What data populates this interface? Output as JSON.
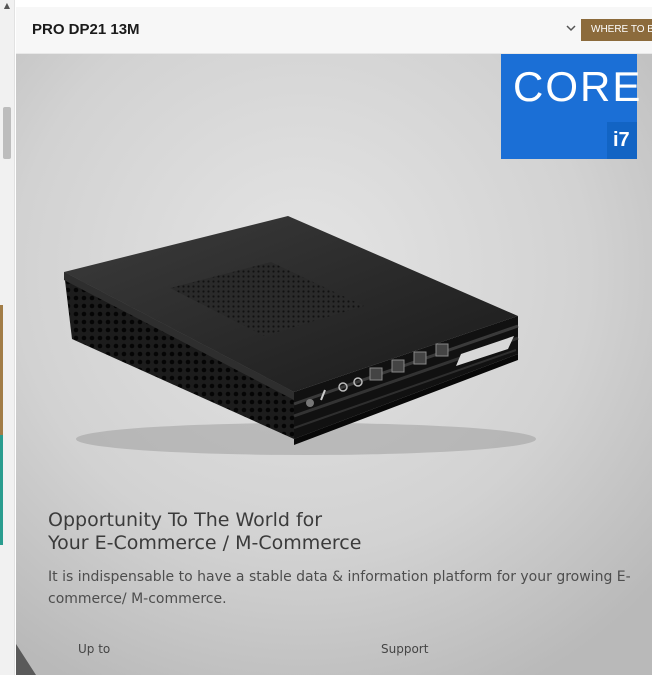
{
  "header": {
    "title": "PRO DP21 13M",
    "cta_label": "WHERE TO BUY"
  },
  "badge": {
    "brand_text": "CORE",
    "tier_text": "i7"
  },
  "hero": {
    "headline_line1": "Opportunity To The World for",
    "headline_line2": "Your E-Commerce / M-Commerce",
    "description": "It is indispensable to have a stable data & information platform for your growing E-commerce/ M-commerce.",
    "stat_left_label": "Up to",
    "stat_right_label": "Support"
  },
  "colors": {
    "accent_gold": "#8c6b3c",
    "intel_blue": "#1b6fd6",
    "background_gray": "#cdcdcd"
  },
  "icons": {
    "dropdown": "chevron-down-icon",
    "product": "mini-pc-image"
  }
}
